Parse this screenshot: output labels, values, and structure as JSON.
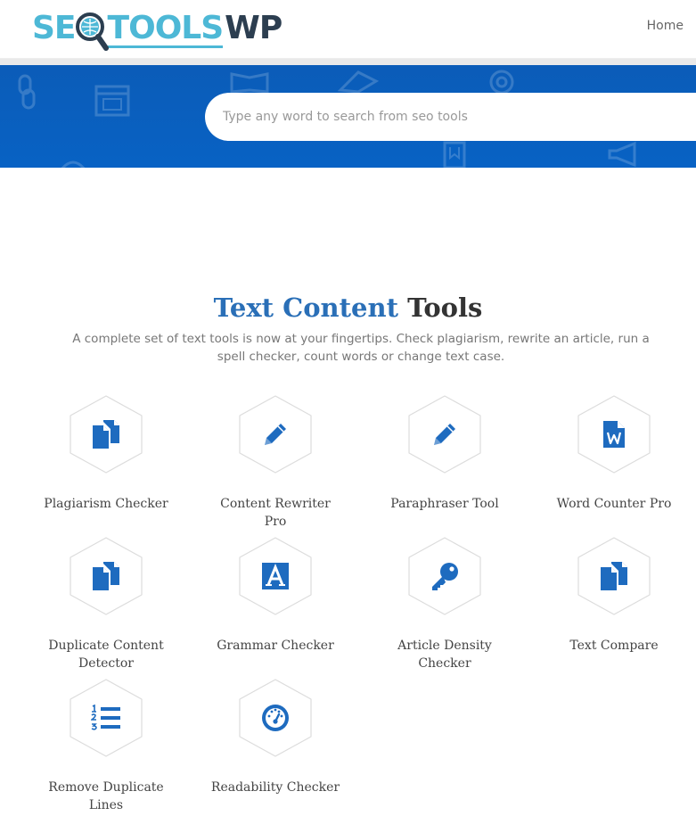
{
  "header": {
    "logo_seo": "SE",
    "logo_tools": "TOOLS",
    "logo_wp": "WP",
    "nav_home": "Home"
  },
  "search": {
    "placeholder": "Type any word to search from seo tools"
  },
  "section": {
    "title_highlight": "Text Content",
    "title_rest": "Tools",
    "description": "A complete set of text tools is now at your fingertips. Check plagiarism, rewrite an article, run a spell checker, count words or change text case."
  },
  "tools": [
    {
      "label": "Plagiarism Checker",
      "icon": "copy-icon"
    },
    {
      "label": "Content Rewriter Pro",
      "icon": "pencil-icon"
    },
    {
      "label": "Paraphraser Tool",
      "icon": "pencil-icon"
    },
    {
      "label": "Word Counter Pro",
      "icon": "word-document-icon"
    },
    {
      "label": "Duplicate Content Detector",
      "icon": "copy-icon"
    },
    {
      "label": "Grammar Checker",
      "icon": "font-a-icon"
    },
    {
      "label": "Article Density Checker",
      "icon": "key-icon"
    },
    {
      "label": "Text Compare",
      "icon": "copy-icon"
    },
    {
      "label": "Remove Duplicate Lines",
      "icon": "numbered-list-icon"
    },
    {
      "label": "Readability Checker",
      "icon": "gauge-icon"
    }
  ],
  "colors": {
    "brand_blue": "#2a6fb7",
    "hero_blue": "#0b5cb8",
    "logo_cyan": "#4db8d6",
    "logo_dark": "#2c3e50",
    "icon_blue": "#1e6bbf"
  }
}
